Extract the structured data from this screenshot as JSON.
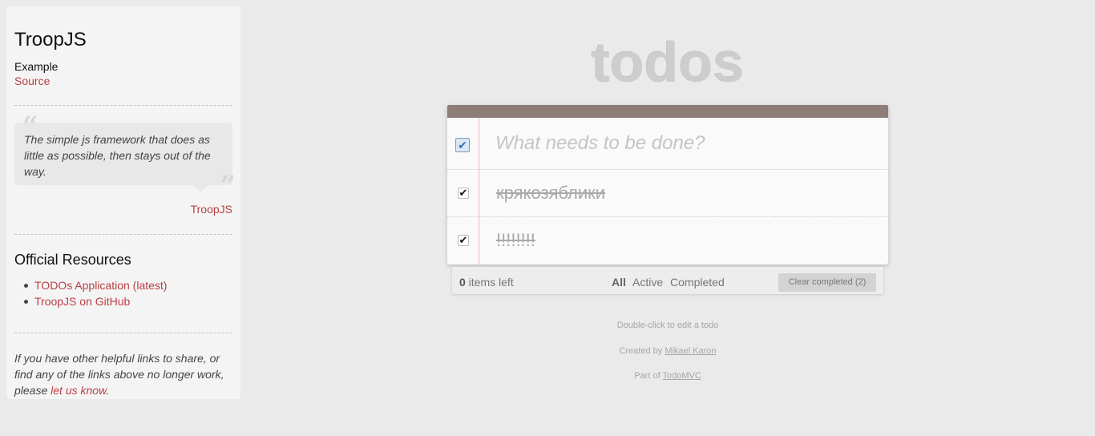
{
  "sidebar": {
    "title": "TroopJS",
    "example_label": "Example",
    "source_link": "Source",
    "quote": "The simple js framework that does as little as possible, then stays out of the way.",
    "quote_author": "TroopJS",
    "resources_heading": "Official Resources",
    "resources": [
      {
        "label": "TODOs Application (latest)"
      },
      {
        "label": "TroopJS on GitHub"
      }
    ],
    "footer_text": "If you have other helpful links to share, or find any of the links above no longer work, please ",
    "footer_link": "let us know",
    "footer_end": "."
  },
  "app": {
    "title": "todos",
    "new_todo_placeholder": "What needs to be done?",
    "todos": [
      {
        "label": "крякозяблики",
        "completed": true
      },
      {
        "label": "!!!!!!!!",
        "completed": true
      }
    ],
    "footer": {
      "count": "0",
      "count_suffix": " items left",
      "filters": [
        "All",
        "Active",
        "Completed"
      ],
      "selected_filter": "All",
      "clear_label": "Clear completed (2)"
    }
  },
  "info": {
    "edit_hint": "Double-click to edit a todo",
    "created_by": "Created by ",
    "author": "Mikael Karon",
    "part_of": "Part of ",
    "todomvc": "TodoMVC"
  },
  "colors": {
    "accent": "#b83f45",
    "header_band": "#8d7d77",
    "background": "#eaeaea"
  }
}
